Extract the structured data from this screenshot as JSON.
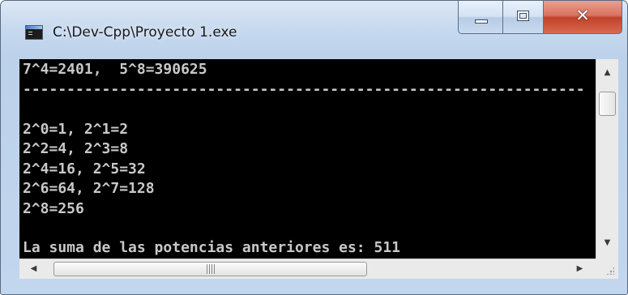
{
  "window": {
    "title": "C:\\Dev-Cpp\\Proyecto 1.exe",
    "app_icon": "console-app-icon",
    "buttons": {
      "minimize": "minimize-icon",
      "maximize": "maximize-icon",
      "close": "✕"
    }
  },
  "console": {
    "background": "#000000",
    "text_color": "#c8c8c8",
    "lines": [
      "7^4=2401,  5^8=390625",
      "----------------------------------------------------------------",
      "",
      "2^0=1, 2^1=2",
      "2^2=4, 2^3=8",
      "2^4=16, 2^5=32",
      "2^6=64, 2^7=128",
      "2^8=256",
      "",
      "La suma de las potencias anteriores es: 511"
    ]
  },
  "scrollbars": {
    "up_arrow": "▲",
    "down_arrow": "▼",
    "left_arrow": "◀",
    "right_arrow": "▶"
  }
}
